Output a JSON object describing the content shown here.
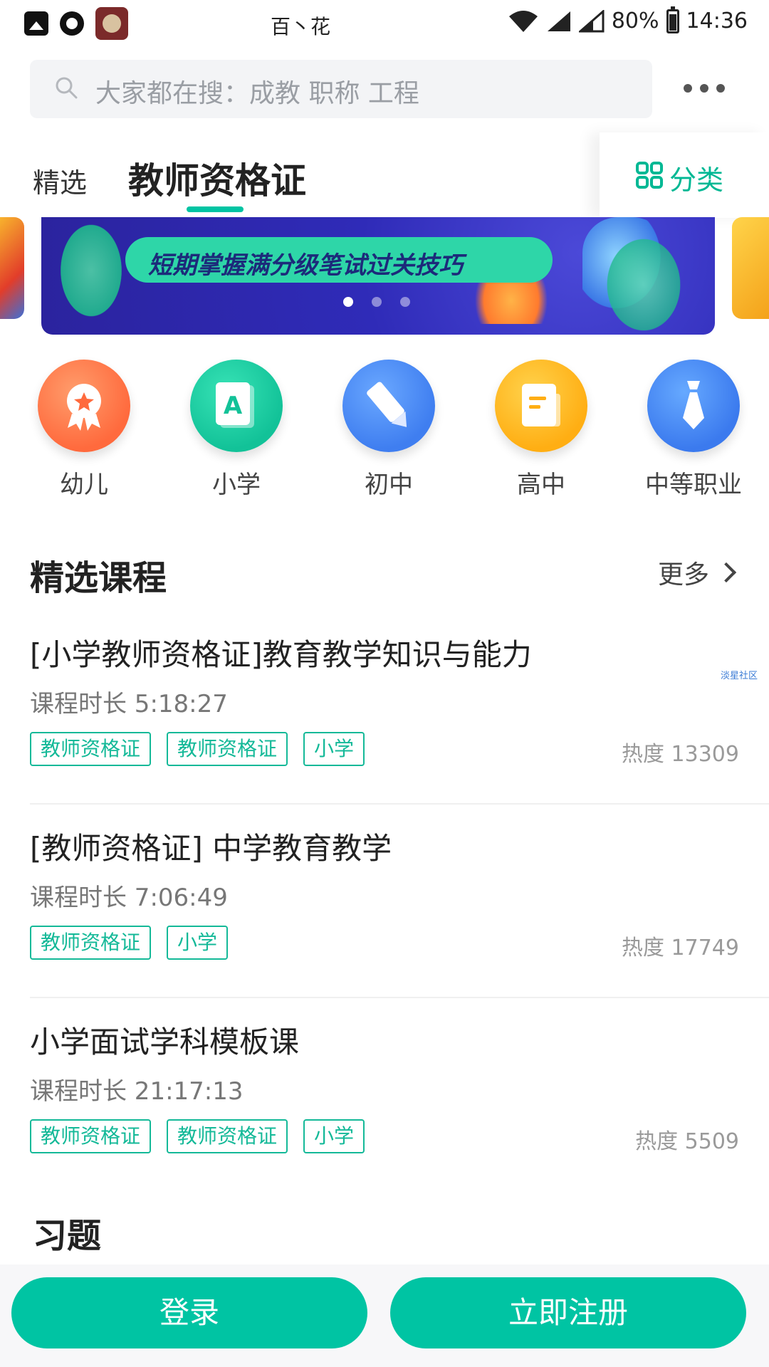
{
  "status_bar": {
    "title": "百丶花",
    "battery": "80%",
    "time": "14:36"
  },
  "search": {
    "placeholder": "大家都在搜：成教 职称 工程"
  },
  "tabs": [
    {
      "label": "精选"
    },
    {
      "label": "教师资格证"
    }
  ],
  "category_button": {
    "label": "分类"
  },
  "banner": {
    "headline": "短期掌握满分级笔试过关技巧",
    "page_indicator": {
      "current": 1,
      "total": 3
    }
  },
  "categories": [
    {
      "label": "幼儿",
      "icon": "award-icon",
      "color": "#ff6a3d"
    },
    {
      "label": "小学",
      "icon": "letter-a-book-icon",
      "color": "#12c298"
    },
    {
      "label": "初中",
      "icon": "pencil-icon",
      "color": "#3f7ef0"
    },
    {
      "label": "高中",
      "icon": "document-icon",
      "color": "#ffae13"
    },
    {
      "label": "中等职业",
      "icon": "necktie-icon",
      "color": "#3b7aee"
    }
  ],
  "section": {
    "title": "精选课程",
    "more": "更多"
  },
  "courses": [
    {
      "title": "[小学教师资格证]教育教学知识与能力",
      "duration": "课程时长 5:18:27",
      "tags": [
        "教师资格证",
        "教师资格证",
        "小学"
      ],
      "heat": "热度 13309"
    },
    {
      "title": "[教师资格证] 中学教育教学",
      "duration": "课程时长 7:06:49",
      "tags": [
        "教师资格证",
        "小学"
      ],
      "heat": "热度 17749"
    },
    {
      "title": "小学面试学科模板课",
      "duration": "课程时长 21:17:13",
      "tags": [
        "教师资格证",
        "教师资格证",
        "小学"
      ],
      "heat": "热度 5509"
    }
  ],
  "watermark": "淡星社区",
  "exercises": {
    "title": "习题"
  },
  "bottom": {
    "login": "登录",
    "register": "立即注册"
  },
  "colors": {
    "accent": "#00c4a3",
    "tag": "#14b998"
  }
}
